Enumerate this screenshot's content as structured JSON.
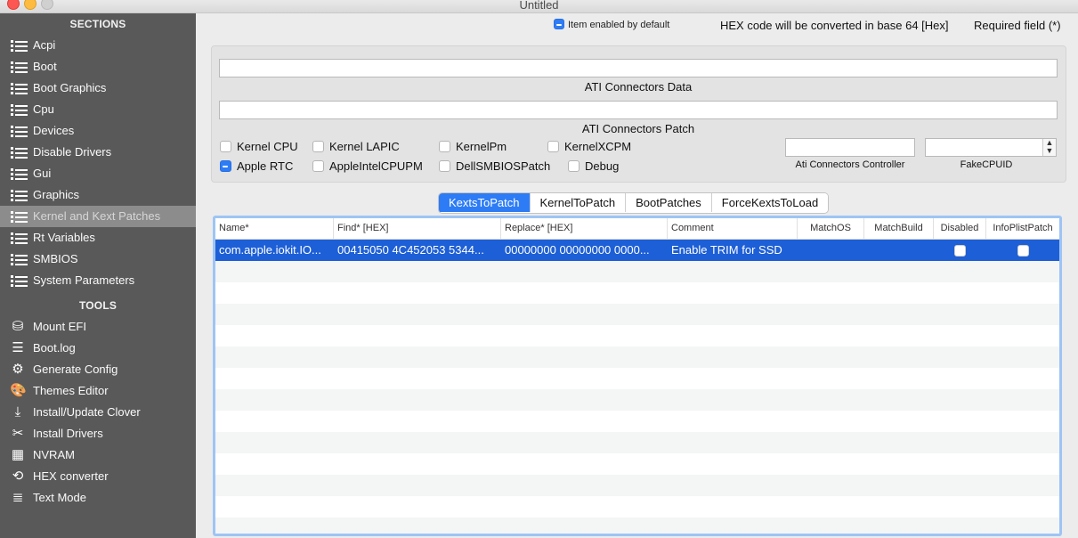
{
  "window": {
    "title": "Untitled"
  },
  "sidebar": {
    "sections_header": "SECTIONS",
    "sections": [
      {
        "label": "Acpi"
      },
      {
        "label": "Boot"
      },
      {
        "label": "Boot Graphics"
      },
      {
        "label": "Cpu"
      },
      {
        "label": "Devices"
      },
      {
        "label": "Disable Drivers"
      },
      {
        "label": "Gui"
      },
      {
        "label": "Graphics"
      },
      {
        "label": "Kernel and Kext Patches",
        "selected": true
      },
      {
        "label": "Rt Variables"
      },
      {
        "label": "SMBIOS"
      },
      {
        "label": "System Parameters"
      }
    ],
    "tools_header": "TOOLS",
    "tools": [
      {
        "label": "Mount EFI",
        "icon": "disk-icon"
      },
      {
        "label": "Boot.log",
        "icon": "log-file-icon"
      },
      {
        "label": "Generate Config",
        "icon": "gears-icon"
      },
      {
        "label": "Themes Editor",
        "icon": "palette-icon"
      },
      {
        "label": "Install/Update Clover",
        "icon": "download-icon"
      },
      {
        "label": "Install Drivers",
        "icon": "tools-icon"
      },
      {
        "label": "NVRAM",
        "icon": "chip-icon"
      },
      {
        "label": "HEX converter",
        "icon": "refresh-icon"
      },
      {
        "label": "Text Mode",
        "icon": "text-lines-icon"
      }
    ]
  },
  "header": {
    "item_enabled_label": "Item enabled by default",
    "hex_note": "HEX code will be converted in base 64 [Hex]",
    "required_note": "Required field (*)"
  },
  "ati": {
    "connectors_data_label": "ATI Connectors Data",
    "connectors_data_value": "",
    "connectors_patch_label": "ATI Connectors Patch",
    "connectors_patch_value": "",
    "controller_label": "Ati Connectors Controller",
    "controller_value": "",
    "fakecpuid_label": "FakeCPUID",
    "fakecpuid_value": ""
  },
  "options": {
    "kernel_cpu": "Kernel CPU",
    "kernel_lapic": "Kernel LAPIC",
    "kernelpm": "KernelPm",
    "kernelxcpm": "KernelXCPM",
    "apple_rtc": "Apple RTC",
    "appleintelcpupm": "AppleIntelCPUPM",
    "dellsmbiospatch": "DellSMBIOSPatch",
    "debug": "Debug"
  },
  "tabs": [
    {
      "label": "KextsToPatch",
      "active": true
    },
    {
      "label": "KernelToPatch"
    },
    {
      "label": "BootPatches"
    },
    {
      "label": "ForceKextsToLoad"
    }
  ],
  "table": {
    "columns": [
      "Name*",
      "Find* [HEX]",
      "Replace* [HEX]",
      "Comment",
      "MatchOS",
      "MatchBuild",
      "Disabled",
      "InfoPlistPatch"
    ],
    "rows": [
      {
        "name": "com.apple.iokit.IO...",
        "find": "00415050 4C452053 5344...",
        "replace": "00000000 00000000 0000...",
        "comment": "Enable TRIM for SSD",
        "matchos": "",
        "matchbuild": "",
        "disabled": false,
        "infoplistpatch": false
      }
    ]
  },
  "colors": {
    "accent": "#2d7cf6",
    "sidebar": "#595959",
    "selection": "#1d5fd6"
  }
}
